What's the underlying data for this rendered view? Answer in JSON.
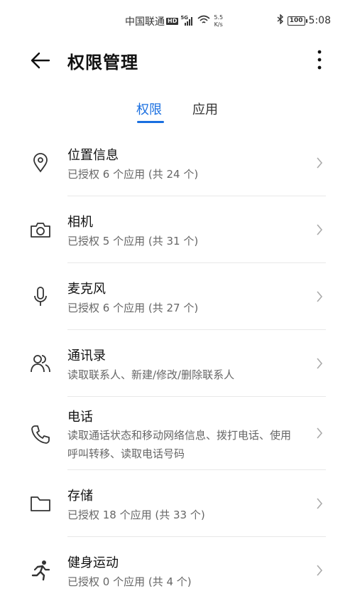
{
  "status_bar": {
    "carrier": "中国联通",
    "hd": "HD",
    "network": "5G",
    "speed_value": "5.5",
    "speed_unit": "K/s",
    "battery": "100",
    "time": "5:08"
  },
  "header": {
    "title": "权限管理"
  },
  "tabs": [
    {
      "label": "权限",
      "active": true
    },
    {
      "label": "应用",
      "active": false
    }
  ],
  "permissions": [
    {
      "icon": "location-pin-icon",
      "title": "位置信息",
      "subtitle": "已授权 6 个应用 (共 24 个)"
    },
    {
      "icon": "camera-icon",
      "title": "相机",
      "subtitle": "已授权 5 个应用 (共 31 个)"
    },
    {
      "icon": "microphone-icon",
      "title": "麦克风",
      "subtitle": "已授权 6 个应用 (共 27 个)"
    },
    {
      "icon": "contacts-icon",
      "title": "通讯录",
      "subtitle": "读取联系人、新建/修改/删除联系人"
    },
    {
      "icon": "phone-icon",
      "title": "电话",
      "subtitle": "读取通话状态和移动网络信息、拨打电话、使用呼叫转移、读取电话号码"
    },
    {
      "icon": "folder-icon",
      "title": "存储",
      "subtitle": "已授权 18 个应用 (共 33 个)"
    },
    {
      "icon": "running-figure-icon",
      "title": "健身运动",
      "subtitle": "已授权 0 个应用 (共 4 个)"
    }
  ],
  "colors": {
    "accent": "#1a6fe0",
    "divider": "#e8e8e8",
    "subtitle": "#666666"
  }
}
